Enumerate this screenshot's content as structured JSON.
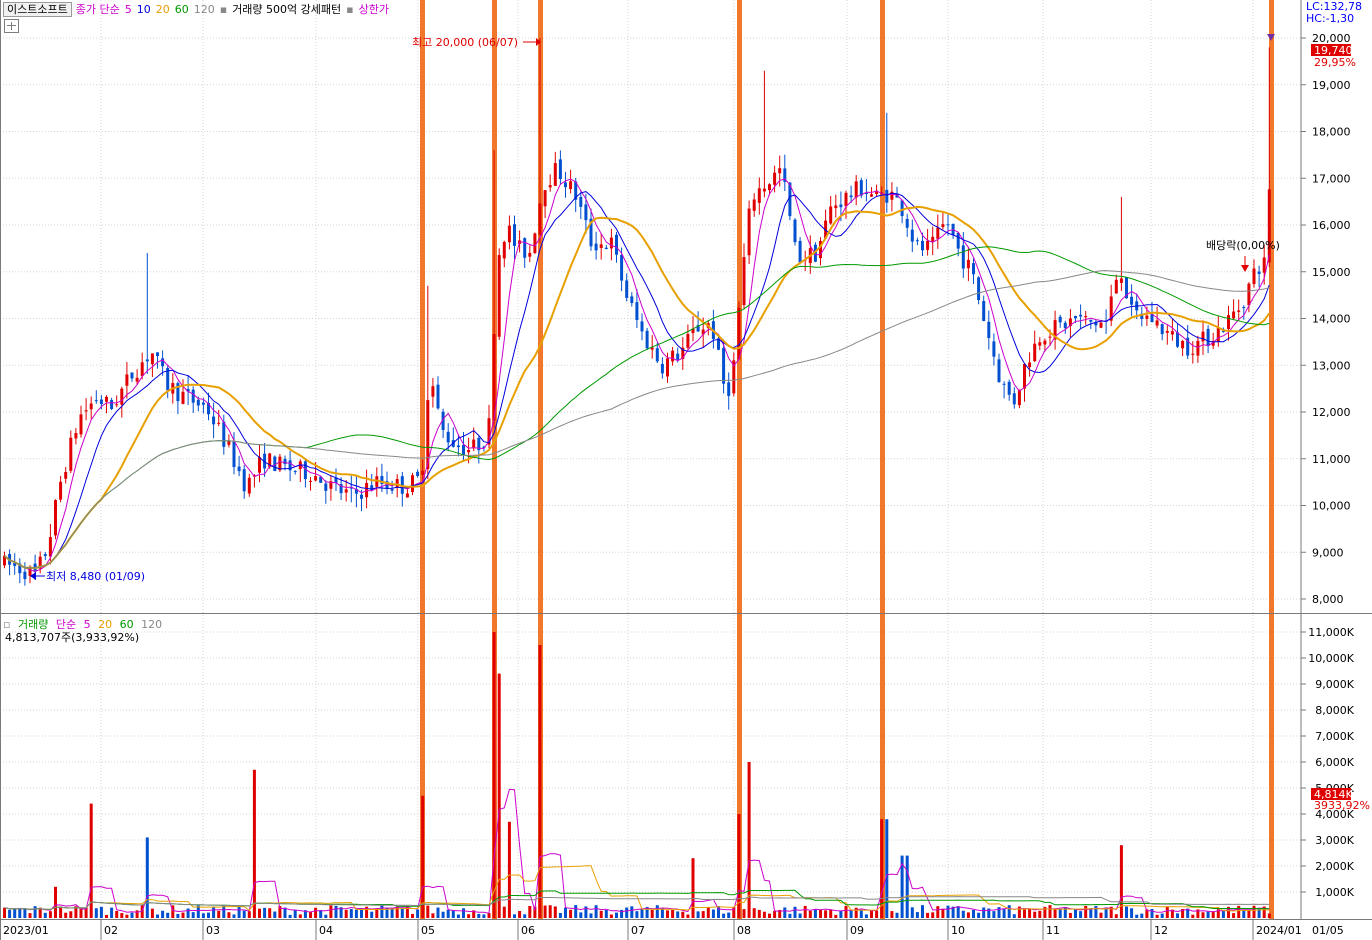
{
  "legend": {
    "stock_name": "이스트소프트",
    "ma_label": "종가 단순",
    "ma_periods": [
      "5",
      "10",
      "20",
      "60",
      "120"
    ],
    "ma_colors": [
      "#cc00cc",
      "#0000dd",
      "#e8a000",
      "#009900",
      "#888888"
    ],
    "pattern_label": "거래량 500억 강세패턴",
    "limit_up_label": "상한가"
  },
  "axis_info": {
    "lc": "LC:132,78",
    "hc": "HC:-1,30"
  },
  "price_axis": {
    "ticks": [
      "20,000",
      "19,000",
      "18,000",
      "17,000",
      "16,000",
      "15,000",
      "14,000",
      "13,000",
      "12,000",
      "11,000",
      "10,000",
      "9,000",
      "8,000"
    ],
    "current_price": "19,740",
    "current_change": "29,95%"
  },
  "volume_axis": {
    "ticks": [
      "11,000K",
      "10,000K",
      "9,000K",
      "8,000K",
      "7,000K",
      "6,000K",
      "5,000K",
      "4,000K",
      "3,000K",
      "2,000K",
      "1,000K"
    ],
    "current_volume": "4,814K",
    "current_ratio": "3933,92%"
  },
  "date_axis": [
    "2023/01",
    "02",
    "03",
    "04",
    "05",
    "06",
    "07",
    "08",
    "09",
    "10",
    "11",
    "12",
    "2024/01",
    "01/05"
  ],
  "annotations": {
    "high": "최고 20,000 (06/07)",
    "low": "최저 8,480 (01/09)",
    "dividend": "배당락(0,00%)"
  },
  "volume_panel": {
    "label": "거래량",
    "ma_label": "단순",
    "ma_periods": [
      "5",
      "20",
      "60",
      "120"
    ],
    "ma_colors": [
      "#cc00cc",
      "#e8a000",
      "#009900",
      "#888888"
    ],
    "info": "4,813,707주(3,933,92%)"
  },
  "colors": {
    "up": "#e00000",
    "down": "#0050d0",
    "highlight": "#f07020",
    "axis_text": "#000000"
  },
  "chart_data": {
    "type": "candlestick",
    "title": "이스트소프트",
    "ylim": [
      7700,
      20450
    ],
    "months": [
      "2023/01",
      "02",
      "03",
      "04",
      "05",
      "06",
      "07",
      "08",
      "09",
      "10",
      "11",
      "12",
      "2024/01"
    ],
    "monthly_close": [
      9200,
      12500,
      10800,
      10100,
      11200,
      15300,
      13200,
      15000,
      16600,
      13000,
      14000,
      13800,
      19740
    ],
    "monthly_volume_peak_k": [
      350,
      4400,
      5700,
      200,
      4700,
      11000,
      1700,
      6000,
      3800,
      1000,
      2800,
      600,
      4814
    ],
    "high": {
      "date": "06/07",
      "value": 20000
    },
    "low": {
      "date": "01/09",
      "value": 8480
    },
    "last_close": 19740,
    "last_change_pct": 29.95,
    "last_volume": 4813707
  }
}
